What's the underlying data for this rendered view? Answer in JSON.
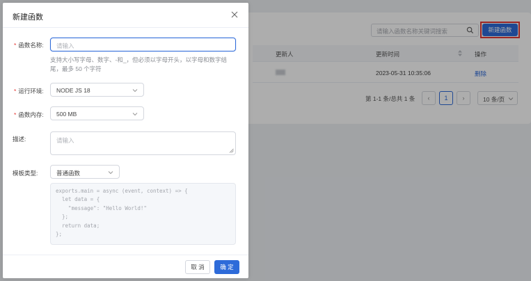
{
  "background": {
    "search": {
      "placeholder": "请输入函数名称关键词搜索",
      "icon": "search-icon"
    },
    "new_function_button": "新建函数",
    "table": {
      "headers": [
        "更新人",
        "更新时间",
        "操作"
      ],
      "rows": [
        {
          "updater": "",
          "updated_at": "2023-05-31 10:35:06",
          "action": "删除"
        }
      ]
    },
    "pagination": {
      "summary": "第 1-1 条/总共 1 条",
      "prev": "‹",
      "current_page": "1",
      "next": "›",
      "page_size": "10 条/页"
    }
  },
  "drawer": {
    "title": "新建函数",
    "fields": {
      "name": {
        "label": "函数名称:",
        "required": "*",
        "placeholder": "请输入",
        "hint": "支持大小写字母、数字、-和_，但必须以字母开头，以字母和数字结尾，最多 50 个字符"
      },
      "runtime": {
        "label": "运行环境:",
        "required": "*",
        "value": "NODE JS 18"
      },
      "memory": {
        "label": "函数内存:",
        "required": "*",
        "value": "500 MB"
      },
      "description": {
        "label": "描述:",
        "placeholder": "请输入"
      },
      "template": {
        "label": "模板类型:",
        "value": "普通函数"
      }
    },
    "code_lines": [
      "exports.main = async (event, context) => {",
      "  let data = {",
      "    \"message\": \"Hello World!\"",
      "  };",
      "  return data;",
      "};"
    ],
    "buttons": {
      "cancel": "取 消",
      "confirm": "确 定"
    }
  },
  "colors": {
    "accent": "#2e6bd9",
    "required": "#e53935",
    "highlight_border": "#e53935"
  }
}
